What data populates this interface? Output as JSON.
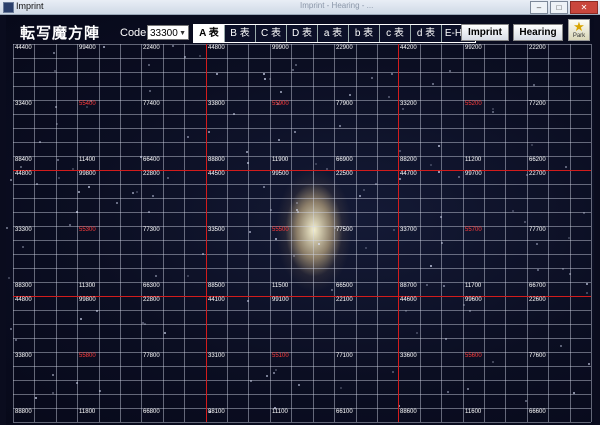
{
  "window": {
    "title": "Imprint",
    "faded_text": "Imprint - Hearing - ...",
    "controls": {
      "minimize": "–",
      "maximize": "□",
      "close": "✕"
    }
  },
  "header": {
    "title": "転写魔方陣",
    "code_label": "Code:",
    "code_value": "33300",
    "tabs": [
      {
        "label": "A 表",
        "active": true
      },
      {
        "label": "B 表",
        "active": false
      },
      {
        "label": "C 表",
        "active": false
      },
      {
        "label": "D 表",
        "active": false
      },
      {
        "label": "a 表",
        "active": false
      },
      {
        "label": "b 表",
        "active": false
      },
      {
        "label": "c 表",
        "active": false
      },
      {
        "label": "d 表",
        "active": false
      },
      {
        "label": "E-H表",
        "active": false
      }
    ],
    "buttons": {
      "imprint": "Imprint",
      "hearing": "Hearing"
    },
    "park_label": "Park",
    "colors": {
      "accent_red": "#ff3b3b",
      "grid_red": "#d21c1c"
    },
    "icons": {
      "park": "star-icon",
      "app": "app-icon"
    }
  },
  "grid": {
    "rows": [
      [
        {
          "v": "44400"
        },
        {
          "v": "99400"
        },
        {
          "v": "22400"
        },
        {
          "v": "44800"
        },
        {
          "v": "99900"
        },
        {
          "v": "22900"
        },
        {
          "v": "44200"
        },
        {
          "v": "99200"
        },
        {
          "v": "22200"
        }
      ],
      [
        {
          "v": "33400"
        },
        {
          "v": "55400",
          "red": true
        },
        {
          "v": "77400"
        },
        {
          "v": "33800"
        },
        {
          "v": "55900",
          "red": true
        },
        {
          "v": "77900"
        },
        {
          "v": "33200"
        },
        {
          "v": "55200",
          "red": true
        },
        {
          "v": "77200"
        }
      ],
      [
        {
          "v": "88400"
        },
        {
          "v": "11400"
        },
        {
          "v": "66400"
        },
        {
          "v": "88800"
        },
        {
          "v": "11900"
        },
        {
          "v": "66900"
        },
        {
          "v": "88200"
        },
        {
          "v": "11200"
        },
        {
          "v": "66200"
        }
      ],
      [
        {
          "v": "44800"
        },
        {
          "v": "99800"
        },
        {
          "v": "22800"
        },
        {
          "v": "44500"
        },
        {
          "v": "99500"
        },
        {
          "v": "22500"
        },
        {
          "v": "44700"
        },
        {
          "v": "99700"
        },
        {
          "v": "22700"
        }
      ],
      [
        {
          "v": "33300"
        },
        {
          "v": "55300",
          "red": true
        },
        {
          "v": "77300"
        },
        {
          "v": "33500"
        },
        {
          "v": "55500",
          "red": true
        },
        {
          "v": "77500"
        },
        {
          "v": "33700"
        },
        {
          "v": "55700",
          "red": true
        },
        {
          "v": "77700"
        }
      ],
      [
        {
          "v": "88300"
        },
        {
          "v": "11300"
        },
        {
          "v": "66300"
        },
        {
          "v": "88500"
        },
        {
          "v": "11500"
        },
        {
          "v": "66500"
        },
        {
          "v": "88700"
        },
        {
          "v": "11700"
        },
        {
          "v": "66700"
        }
      ],
      [
        {
          "v": "44800"
        },
        {
          "v": "99800"
        },
        {
          "v": "22800"
        },
        {
          "v": "44100"
        },
        {
          "v": "99100"
        },
        {
          "v": "22100"
        },
        {
          "v": "44600"
        },
        {
          "v": "99600"
        },
        {
          "v": "22600"
        }
      ],
      [
        {
          "v": "33800"
        },
        {
          "v": "55800",
          "red": true
        },
        {
          "v": "77800"
        },
        {
          "v": "33100"
        },
        {
          "v": "55100",
          "red": true
        },
        {
          "v": "77100"
        },
        {
          "v": "33600"
        },
        {
          "v": "55600",
          "red": true
        },
        {
          "v": "77600"
        }
      ],
      [
        {
          "v": "88800"
        },
        {
          "v": "11800"
        },
        {
          "v": "66800"
        },
        {
          "v": "88100"
        },
        {
          "v": "11100"
        },
        {
          "v": "66100"
        },
        {
          "v": "88600"
        },
        {
          "v": "11600"
        },
        {
          "v": "66600"
        }
      ]
    ]
  }
}
